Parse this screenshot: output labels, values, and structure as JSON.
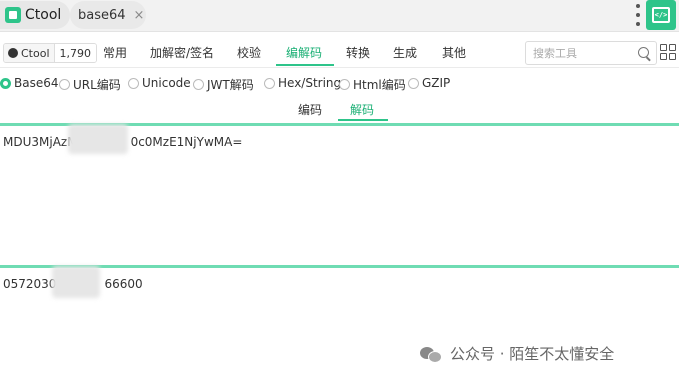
{
  "app": {
    "name": "Ctool"
  },
  "file_tab": {
    "label": "base64",
    "close": "×"
  },
  "github": {
    "label": "Ctool",
    "stars": "1,790"
  },
  "categories": [
    {
      "label": "常用"
    },
    {
      "label": "加解密/签名"
    },
    {
      "label": "校验"
    },
    {
      "label": "编解码",
      "active": true
    },
    {
      "label": "转换"
    },
    {
      "label": "生成"
    },
    {
      "label": "其他"
    }
  ],
  "search": {
    "placeholder": "搜索工具"
  },
  "tools": [
    {
      "label": "Base64",
      "selected": true
    },
    {
      "label": "URL编码"
    },
    {
      "label": "Unicode"
    },
    {
      "label": "JWT解码"
    },
    {
      "label": "Hex/String"
    },
    {
      "label": "Html编码"
    },
    {
      "label": "GZIP"
    }
  ],
  "mode_tabs": [
    {
      "label": "编码"
    },
    {
      "label": "解码",
      "active": true
    }
  ],
  "input": {
    "before": "MDU3MjAzM",
    "after": "0c0MzE1NjYwMA="
  },
  "output": {
    "before": "0572030",
    "after": "66600"
  },
  "watermark": {
    "text": "公众号 · 陌笙不太懂安全"
  },
  "colors": {
    "accent": "#2ec48a",
    "accent_text": "#1aaf74",
    "area_border": "#6fdcb3"
  }
}
